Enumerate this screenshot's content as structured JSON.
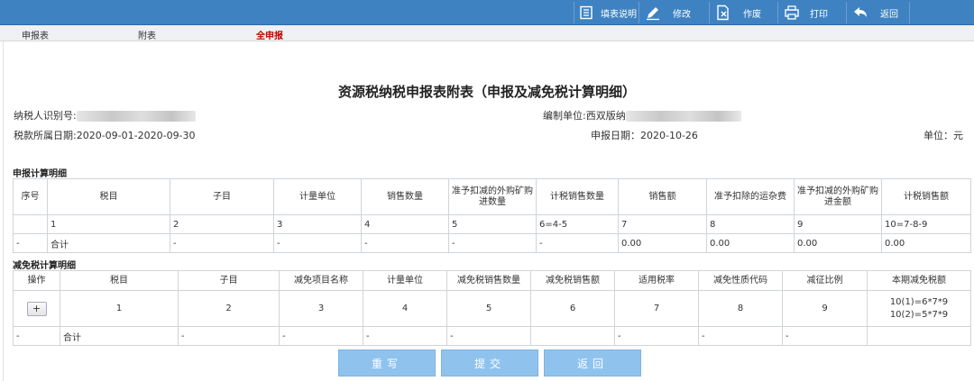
{
  "toolbar": {
    "fill_help_label": "填表说明",
    "modify_label": "修改",
    "void_label": "作废",
    "print_label": "打印",
    "back_label": "返回"
  },
  "tabs": [
    {
      "label": "申报表",
      "active": false
    },
    {
      "label": "附表",
      "active": false
    },
    {
      "label": "全申报",
      "active": true
    }
  ],
  "title": "资源税纳税申报表附表（申报及减免税计算明细）",
  "info": {
    "taxpayer_id_label": "纳税人识别号:",
    "prep_unit_label": "编制单位:西双版纳",
    "period_label": "税款所属日期:2020-09-01-2020-09-30",
    "filing_date_label": "申报日期：2020-10-26",
    "unit_label": "单位：元"
  },
  "declare_section": {
    "label": "申报计算明细",
    "headers": [
      "序号",
      "税目",
      "子目",
      "计量单位",
      "销售数量",
      "准予扣减的外购矿购进数量",
      "计税销售数量",
      "销售额",
      "准予扣除的运杂费",
      "准予扣减的外购矿购进金额",
      "计税销售额"
    ],
    "index_row": [
      "",
      "1",
      "2",
      "3",
      "4",
      "5",
      "6=4-5",
      "7",
      "8",
      "9",
      "10=7-8-9"
    ],
    "total_row": [
      "-",
      "合计",
      "-",
      "-",
      "-",
      "-",
      "-",
      "0.00",
      "0.00",
      "0.00",
      "0.00"
    ]
  },
  "relief_section": {
    "label": "减免税计算明细",
    "headers": [
      "操作",
      "税目",
      "子目",
      "减免项目名称",
      "计量单位",
      "减免税销售数量",
      "减免税销售额",
      "适用税率",
      "减免性质代码",
      "减征比例",
      "本期减免税额"
    ],
    "add_button_label": "+",
    "index_row": [
      "",
      "1",
      "2",
      "3",
      "4",
      "5",
      "6",
      "7",
      "8",
      "9"
    ],
    "index_last_line1": "10(1)=6*7*9",
    "index_last_line2": "10(2)=5*7*9",
    "total_row": [
      "-",
      "合计",
      "-",
      "-",
      "-",
      "-",
      "",
      "-",
      "-",
      "-",
      ""
    ]
  },
  "actions": {
    "reset_label": "重写",
    "submit_label": "提交",
    "return_label": "返回"
  }
}
